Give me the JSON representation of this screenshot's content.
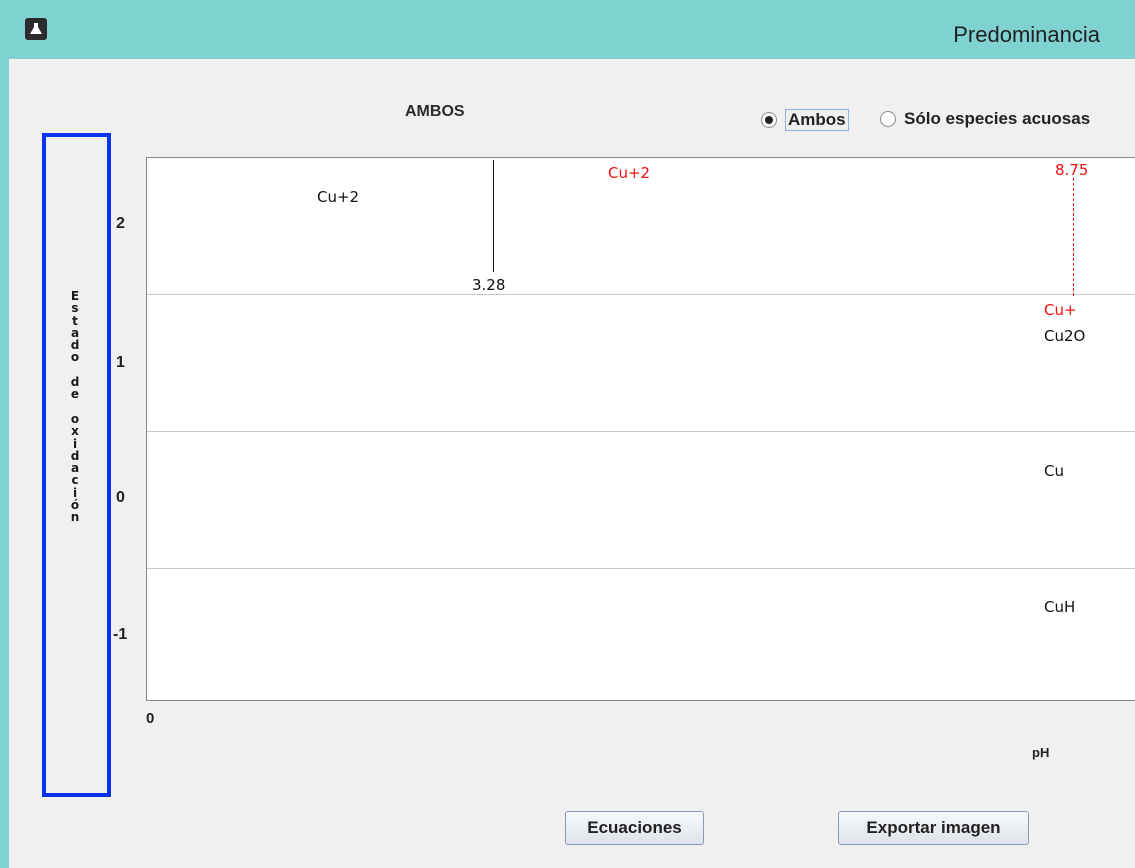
{
  "window": {
    "title": "Predominancia",
    "app_icon": "flask-icon"
  },
  "diagram": {
    "title": "AMBOS"
  },
  "options": {
    "ambos_label": "Ambos",
    "aquosas_label": "Sólo especies acuosas",
    "selected": "Ambos"
  },
  "axis": {
    "ylabel": "Estado de oxidación",
    "yticks": [
      "2",
      "1",
      "0",
      "-1"
    ],
    "xtick": "0",
    "xlabel": "pH"
  },
  "species": {
    "solid_cu2": "Cu+2",
    "aq_cu2": "Cu+2",
    "aq_cu1": "Cu+",
    "solid_cu2o": "Cu2O",
    "solid_cu": "Cu",
    "solid_cuh": "CuH"
  },
  "boundaries": {
    "solid_ph": "3.28",
    "aqueous_ph": "8.75"
  },
  "colors": {
    "solid": "#111111",
    "aqueous": "#f01010",
    "highlight_border": "#0a33f0",
    "titlebar": "#7fd2d0"
  },
  "buttons": {
    "equations": "Ecuaciones",
    "export": "Exportar imagen"
  }
}
